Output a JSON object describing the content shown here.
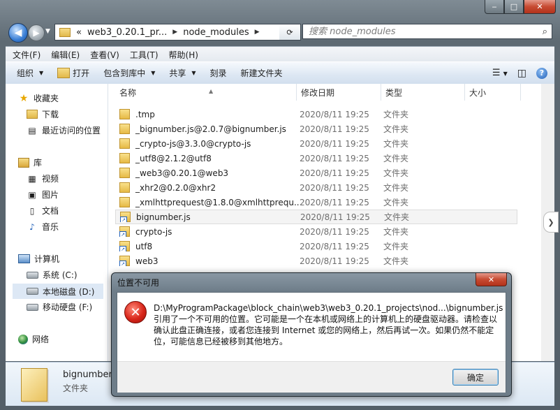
{
  "window": {
    "caption_min": "‒",
    "caption_max": "□",
    "caption_close": "✕"
  },
  "nav": {
    "back": "◀",
    "forward": "▶",
    "address_overflow": "«",
    "path": [
      "web3_0.20.1_pr...",
      "node_modules"
    ],
    "search_placeholder": "搜索 node_modules",
    "search_icon": "⌕"
  },
  "menu": [
    "文件(F)",
    "编辑(E)",
    "查看(V)",
    "工具(T)",
    "帮助(H)"
  ],
  "toolbar": {
    "organize": "组织",
    "open": "打开",
    "include_library": "包含到库中",
    "share": "共享",
    "burn": "刻录",
    "new_folder": "新建文件夹",
    "help": "?"
  },
  "sidebar": {
    "favorites": "收藏夹",
    "downloads": "下载",
    "recent": "最近访问的位置",
    "libraries": "库",
    "videos": "视频",
    "pictures": "图片",
    "documents": "文档",
    "music": "音乐",
    "computer": "计算机",
    "system_c": "系统 (C:)",
    "local_d": "本地磁盘 (D:)",
    "removable_f": "移动硬盘 (F:)",
    "network": "网络"
  },
  "columns": {
    "name": "名称",
    "date": "修改日期",
    "type": "类型",
    "size": "大小"
  },
  "files": [
    {
      "name": ".tmp",
      "date": "2020/8/11 19:25",
      "type": "文件夹",
      "kind": "folder"
    },
    {
      "name": "_bignumber.js@2.0.7@bignumber.js",
      "date": "2020/8/11 19:25",
      "type": "文件夹",
      "kind": "folder"
    },
    {
      "name": "_crypto-js@3.3.0@crypto-js",
      "date": "2020/8/11 19:25",
      "type": "文件夹",
      "kind": "folder"
    },
    {
      "name": "_utf8@2.1.2@utf8",
      "date": "2020/8/11 19:25",
      "type": "文件夹",
      "kind": "folder"
    },
    {
      "name": "_web3@0.20.1@web3",
      "date": "2020/8/11 19:25",
      "type": "文件夹",
      "kind": "folder"
    },
    {
      "name": "_xhr2@0.2.0@xhr2",
      "date": "2020/8/11 19:25",
      "type": "文件夹",
      "kind": "folder"
    },
    {
      "name": "_xmlhttprequest@1.8.0@xmlhttprequ...",
      "date": "2020/8/11 19:25",
      "type": "文件夹",
      "kind": "folder"
    },
    {
      "name": "bignumber.js",
      "date": "2020/8/11 19:25",
      "type": "文件夹",
      "kind": "shortcut"
    },
    {
      "name": "crypto-js",
      "date": "2020/8/11 19:25",
      "type": "文件夹",
      "kind": "shortcut"
    },
    {
      "name": "utf8",
      "date": "2020/8/11 19:25",
      "type": "文件夹",
      "kind": "shortcut"
    },
    {
      "name": "web3",
      "date": "2020/8/11 19:25",
      "type": "文件夹",
      "kind": "shortcut"
    }
  ],
  "details": {
    "name": "bignumber.",
    "type": "文件夹"
  },
  "dialog": {
    "title": "位置不可用",
    "message": "D:\\MyProgramPackage\\block_chain\\web3\\web3_0.20.1_projects\\nod...\\bignumber.js 引用了一个不可用的位置。它可能是一个在本机或网络上的计算机上的硬盘驱动器。请检查以确认此盘正确连接，或者您连接到 Internet 或您的网络上，然后再试一次。如果仍然不能定位，可能信息已经被移到其他地方。",
    "ok": "确定",
    "close": "✕",
    "error_glyph": "✕"
  }
}
